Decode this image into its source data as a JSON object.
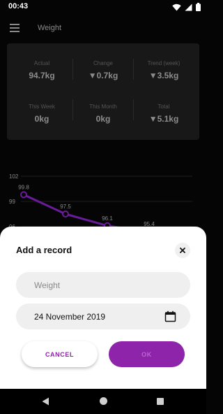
{
  "status_bar": {
    "time": "00:43",
    "icons": [
      "wifi-icon",
      "signal-icon",
      "battery-icon"
    ]
  },
  "app_bar": {
    "title": "Weight",
    "menu_icon": "menu-icon"
  },
  "stats": {
    "actual": {
      "label": "Actual",
      "value": "94.7kg"
    },
    "change": {
      "label": "Change",
      "value": "▼0.7kg"
    },
    "trend_week": {
      "label": "Trend (week)",
      "value": "▼3.5kg"
    },
    "this_week": {
      "label": "This Week",
      "value": "0kg"
    },
    "this_month": {
      "label": "This Month",
      "value": "0kg"
    },
    "total": {
      "label": "Total",
      "value": "▼5.1kg"
    }
  },
  "chart_data": {
    "type": "line",
    "y_ticks": [
      "102",
      "99",
      "96"
    ],
    "ylim": [
      96,
      102
    ],
    "values": [
      99.8,
      97.5,
      96.1,
      95.4
    ],
    "labels": [
      "99.8",
      "97.5",
      "96.1",
      "95.4"
    ],
    "line_color": "#6a1b9a",
    "grid": true
  },
  "dialog": {
    "title": "Add a record",
    "close_icon": "close-icon",
    "weight_placeholder": "Weight",
    "weight_value": "",
    "date_value": "24 November 2019",
    "calendar_icon": "calendar-icon",
    "cancel_label": "CANCEL",
    "ok_label": "OK"
  },
  "colors": {
    "accent": "#8e24aa",
    "background": "#050505",
    "card": "#181818",
    "sheet": "#ffffff"
  },
  "nav_bar": {
    "icons": [
      "back-icon",
      "home-icon",
      "recents-icon"
    ]
  }
}
